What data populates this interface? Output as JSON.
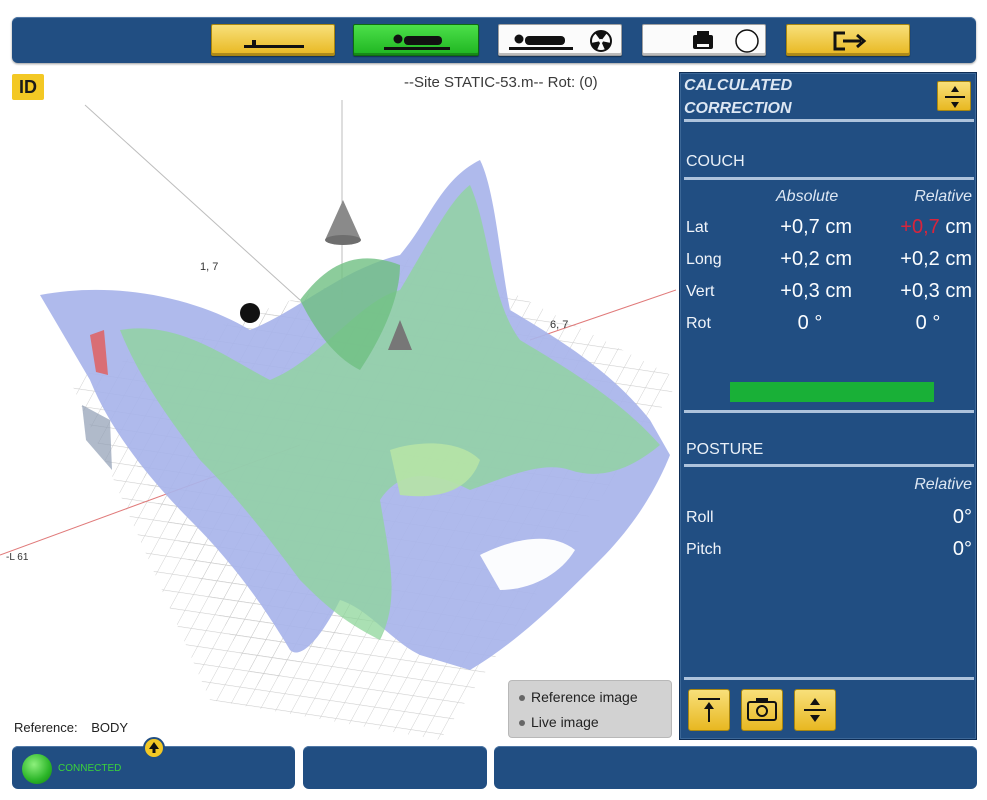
{
  "viewer": {
    "id_badge": "ID",
    "site_label": "--Site   STATIC-53.m-- Rot: (0)",
    "reference_label": "Reference:",
    "reference_value": "BODY",
    "axis_labels": [
      "1, 7",
      "6, 7",
      "-L 61"
    ],
    "image_options": [
      "Reference image",
      "Live image"
    ]
  },
  "panel": {
    "title_line1": "CALCULATED",
    "title_line2": "CORRECTION",
    "couch": {
      "header": "COUCH",
      "col_absolute": "Absolute",
      "col_relative": "Relative",
      "rows": [
        {
          "label": "Lat",
          "absolute": "+0,7 cm",
          "relative_value": "+0,7",
          "relative_unit": " cm"
        },
        {
          "label": "Long",
          "absolute": "+0,2 cm",
          "relative_value": "+0,2",
          "relative_unit": " cm"
        },
        {
          "label": "Vert",
          "absolute": "+0,3 cm",
          "relative_value": "+0,3",
          "relative_unit": " cm"
        },
        {
          "label": "Rot",
          "absolute": "0 °",
          "relative_value": "0 °",
          "relative_unit": ""
        }
      ]
    },
    "posture": {
      "header": "POSTURE",
      "col_relative": "Relative",
      "rows": [
        {
          "label": "Roll",
          "value": "0°"
        },
        {
          "label": "Pitch",
          "value": "0°"
        }
      ]
    }
  },
  "status": {
    "connection_text": "CONNECTED"
  },
  "colors": {
    "panel_bg": "#214e82",
    "button_yellow": "#f0c836",
    "button_green": "#2fc42f",
    "status_green": "#19b037",
    "alert_red": "#d8243c"
  },
  "icons": {
    "toolbar": [
      "couch-flat-icon",
      "patient-on-couch-icon",
      "patient-radiation-icon",
      "printer-icon",
      "exit-icon"
    ],
    "panel": [
      "align-icon",
      "fit-icon",
      "camera-icon",
      "align-icon"
    ]
  }
}
